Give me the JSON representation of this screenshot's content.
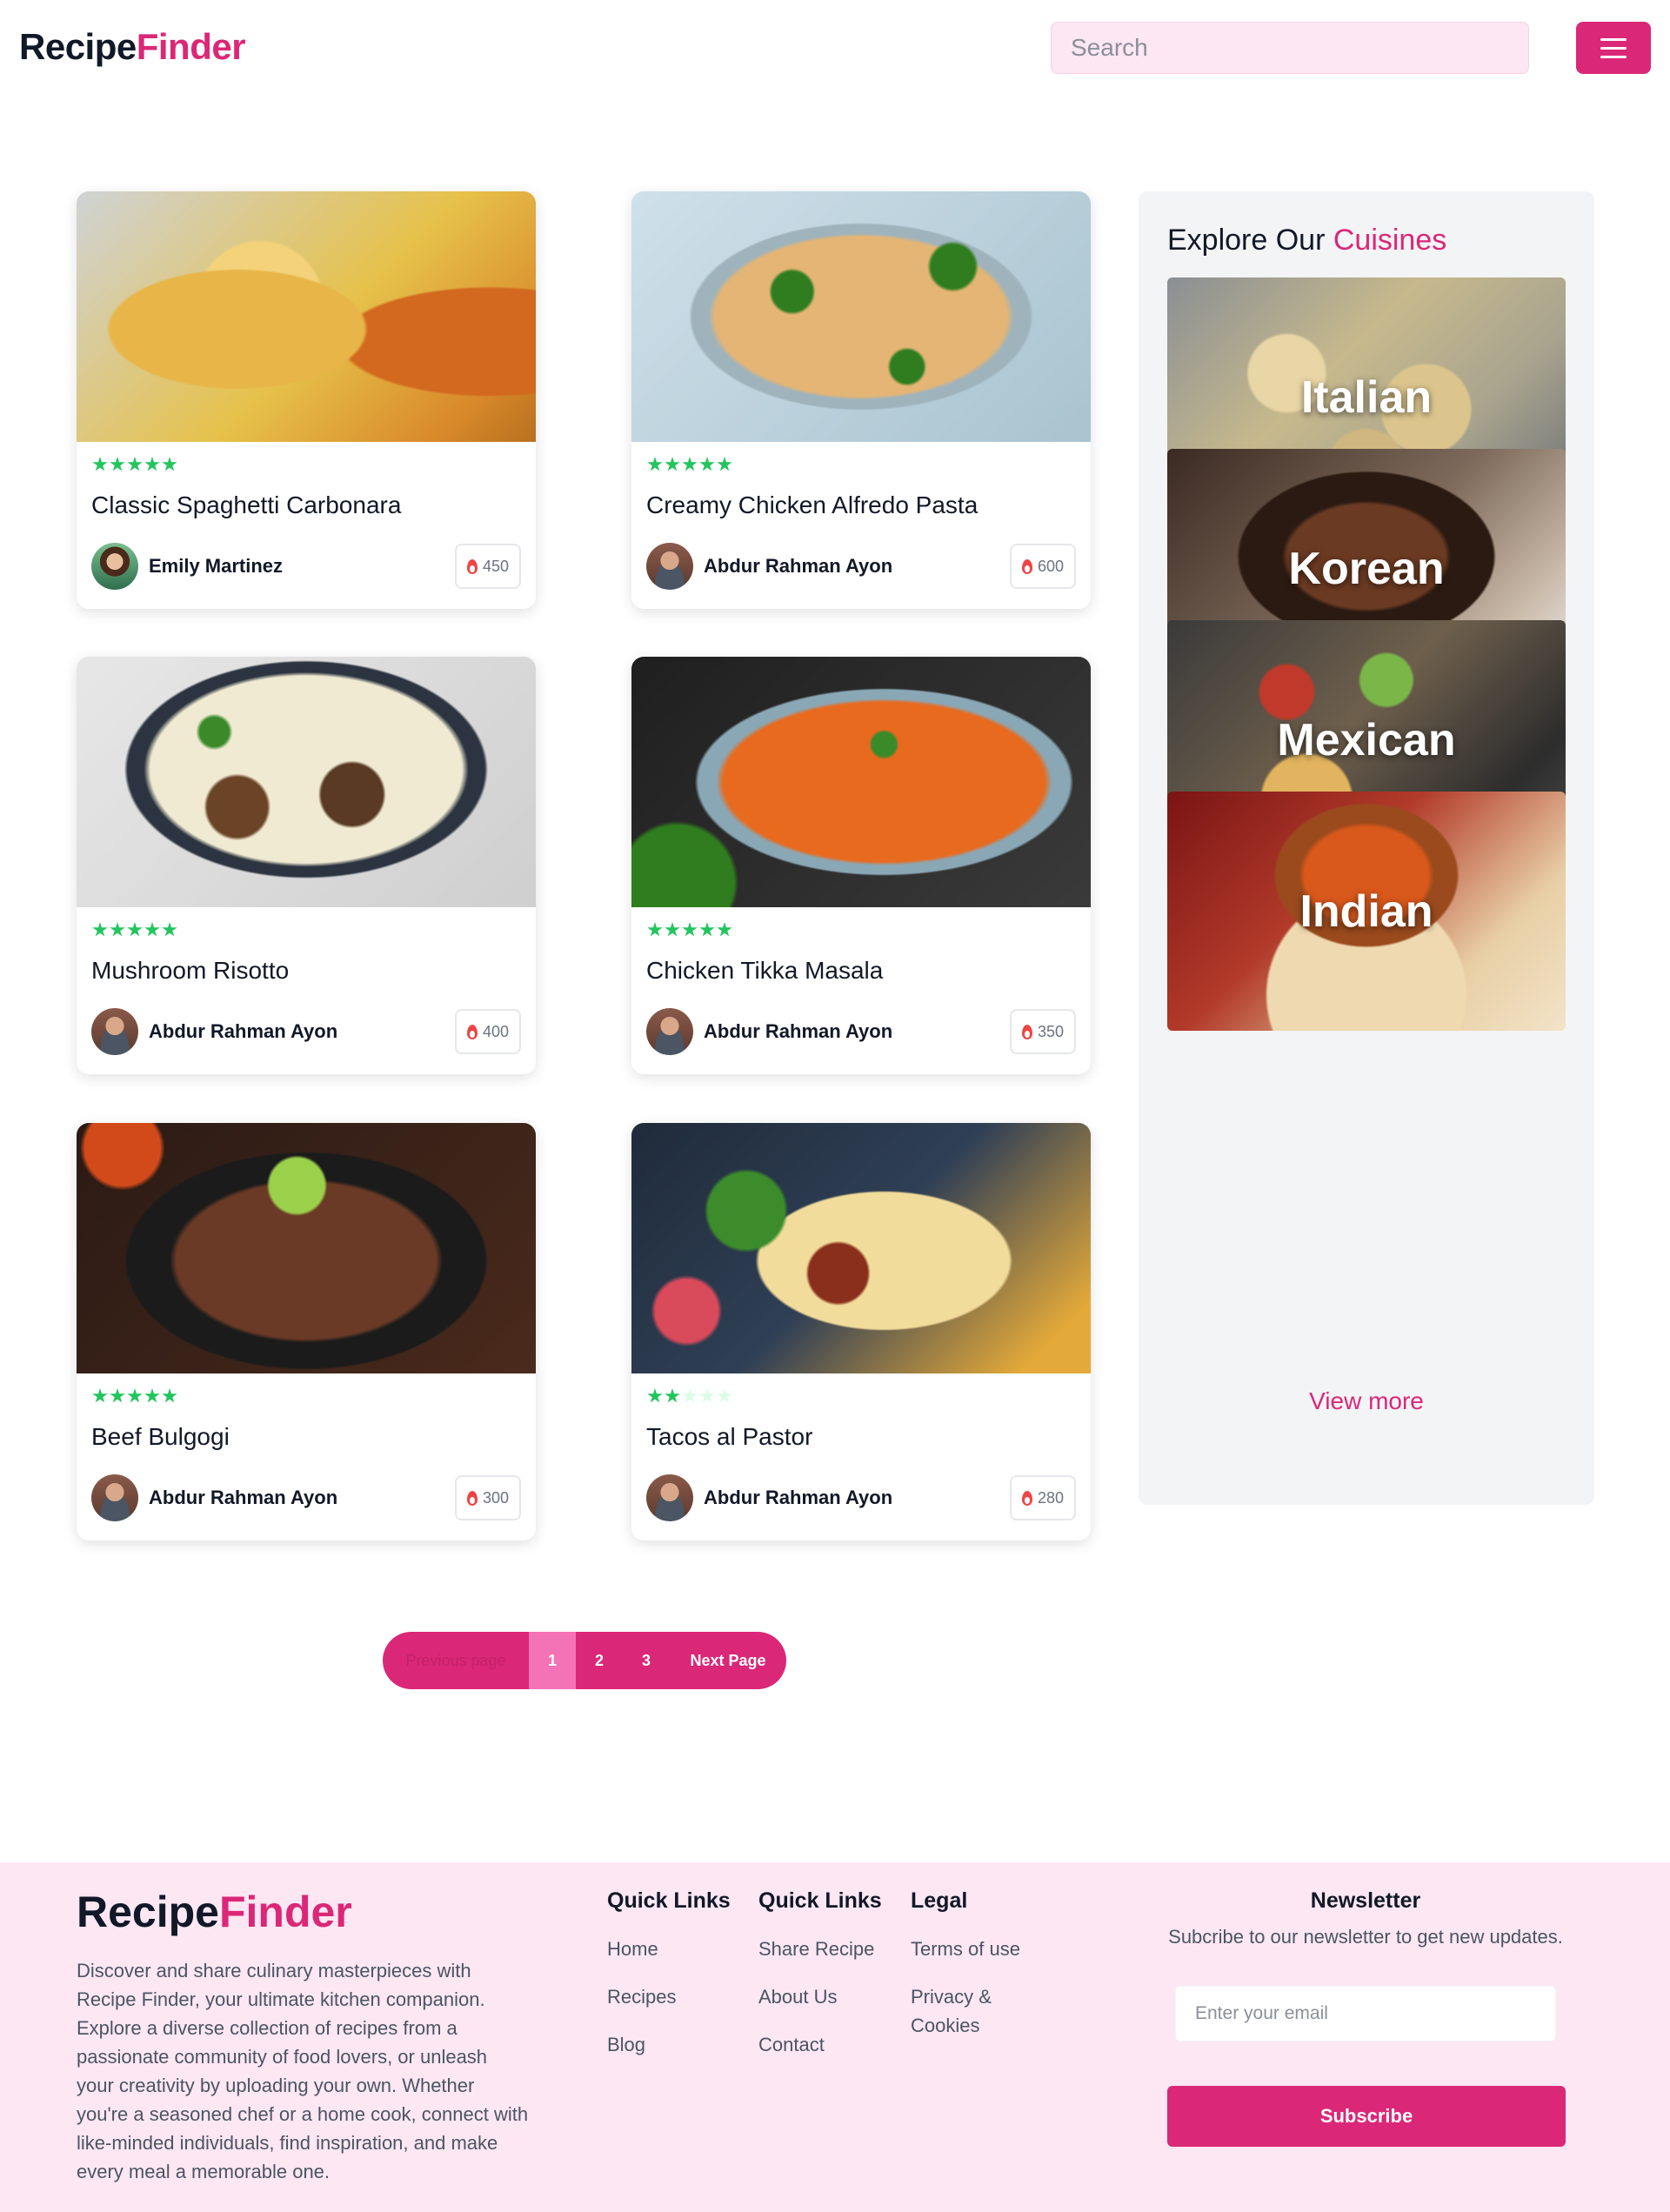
{
  "header": {
    "logo_part1": "Recipe",
    "logo_part2": "Finder",
    "search_placeholder": "Search",
    "menu_icon": "hamburger-menu-icon"
  },
  "recipes": [
    {
      "title": "Classic Spaghetti Carbonara",
      "rating": 5,
      "author": "Emily Martinez",
      "calories": "450"
    },
    {
      "title": "Creamy Chicken Alfredo Pasta",
      "rating": 5,
      "author": "Abdur Rahman Ayon",
      "calories": "600"
    },
    {
      "title": "Mushroom Risotto",
      "rating": 5,
      "author": "Abdur Rahman Ayon",
      "calories": "400"
    },
    {
      "title": "Chicken Tikka Masala",
      "rating": 5,
      "author": "Abdur Rahman Ayon",
      "calories": "350"
    },
    {
      "title": "Beef Bulgogi",
      "rating": 5,
      "author": "Abdur Rahman Ayon",
      "calories": "300"
    },
    {
      "title": "Tacos al Pastor",
      "rating": 2,
      "author": "Abdur Rahman Ayon",
      "calories": "280"
    }
  ],
  "sidebar": {
    "heading_part1": "Explore Our ",
    "heading_part2": "Cuisines",
    "cuisines": [
      "Italian",
      "Korean",
      "Mexican",
      "Indian"
    ],
    "view_more": "View more"
  },
  "pagination": {
    "previous": "Previous page",
    "pages": [
      "1",
      "2",
      "3"
    ],
    "active_page": "1",
    "next": "Next Page"
  },
  "footer": {
    "logo_part1": "Recipe",
    "logo_part2": "Finder",
    "description": "Discover and share culinary masterpieces with Recipe Finder, your ultimate kitchen companion. Explore a diverse collection of recipes from a passionate community of food lovers, or unleash your creativity by uploading your own. Whether you're a seasoned chef or a home cook, connect with like-minded individuals, find inspiration, and make every meal a memorable one.",
    "columns": [
      {
        "heading": "Quick Links",
        "links": [
          "Home",
          "Recipes",
          "Blog"
        ]
      },
      {
        "heading": "Quick Links",
        "links": [
          "Share Recipe",
          "About Us",
          "Contact"
        ]
      },
      {
        "heading": "Legal",
        "links": [
          "Terms of use",
          "Privacy & Cookies"
        ]
      }
    ],
    "newsletter": {
      "heading": "Newsletter",
      "text": "Subcribe to our newsletter to get new updates.",
      "email_placeholder": "Enter your email",
      "button": "Subscribe"
    }
  },
  "colors": {
    "brand": "#db2777",
    "brand_light": "#fce7f3",
    "star": "#22c55e",
    "flame": "#ef4444"
  }
}
